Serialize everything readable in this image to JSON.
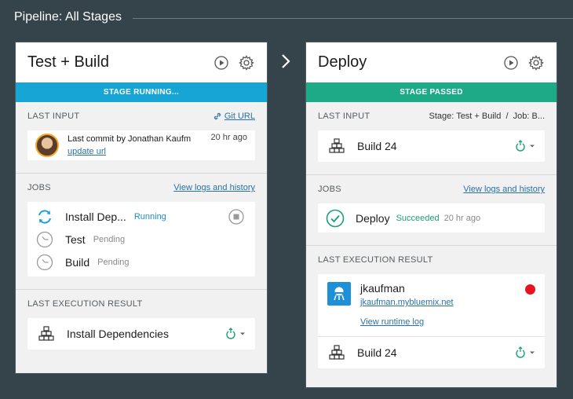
{
  "header": {
    "title": "Pipeline: All Stages"
  },
  "stages": [
    {
      "title": "Test + Build",
      "status": "STAGE RUNNING...",
      "status_color": "#16a5d5",
      "last_input": {
        "label": "LAST INPUT",
        "link": "Git URL",
        "commit_text": "Last commit by Jonathan Kaufm",
        "commit_time": "20 hr ago",
        "commit_link": "update url"
      },
      "jobs": {
        "label": "JOBS",
        "link": "View logs and history",
        "items": [
          {
            "name": "Install Dep...",
            "status": "Running",
            "icon": "sync-icon"
          },
          {
            "name": "Test",
            "status": "Pending",
            "icon": "clock-icon"
          },
          {
            "name": "Build",
            "status": "Pending",
            "icon": "clock-icon"
          }
        ]
      },
      "last_execution": {
        "label": "LAST EXECUTION RESULT",
        "build_name": "Install Dependencies"
      }
    },
    {
      "title": "Deploy",
      "status": "STAGE PASSED",
      "status_color": "#1dab87",
      "last_input": {
        "label": "LAST INPUT",
        "info": "Stage: Test + Build  /  Job: B...",
        "build_name": "Build 24"
      },
      "jobs": {
        "label": "JOBS",
        "link": "View logs and history",
        "items": [
          {
            "name": "Deploy",
            "status": "Succeeded",
            "time": "20 hr ago",
            "icon": "check-circle-icon"
          }
        ]
      },
      "last_execution": {
        "label": "LAST EXECUTION RESULT",
        "app_name": "jkaufman",
        "app_url": "jkaufman.mybluemix.net",
        "runtime_link": "View runtime log",
        "app_status_color": "#e8131e",
        "build_name": "Build 24"
      }
    }
  ]
}
